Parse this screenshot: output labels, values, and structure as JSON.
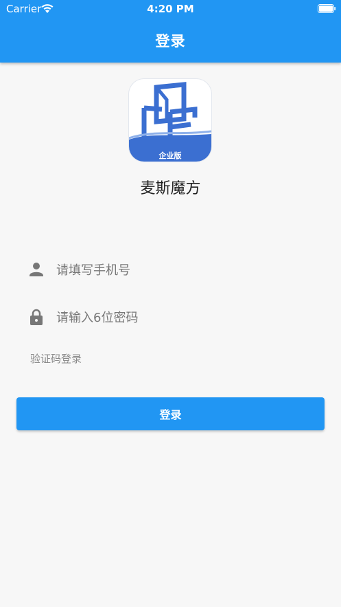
{
  "status_bar": {
    "carrier": "Carrier",
    "time": "4:20 PM",
    "wifi_icon": "wifi-icon",
    "battery_icon": "battery-icon"
  },
  "header": {
    "title": "登录"
  },
  "logo": {
    "badge": "企业版",
    "brand_color": "#3b6fd1"
  },
  "app": {
    "name": "麦斯魔方"
  },
  "form": {
    "phone": {
      "placeholder": "请填写手机号",
      "value": "",
      "icon": "person-icon"
    },
    "password": {
      "placeholder": "请输入6位密码",
      "value": "",
      "icon": "lock-icon"
    },
    "code_login_link": "验证码登录",
    "submit_label": "登录"
  },
  "colors": {
    "primary": "#2196f3",
    "background": "#f7f7f7"
  }
}
